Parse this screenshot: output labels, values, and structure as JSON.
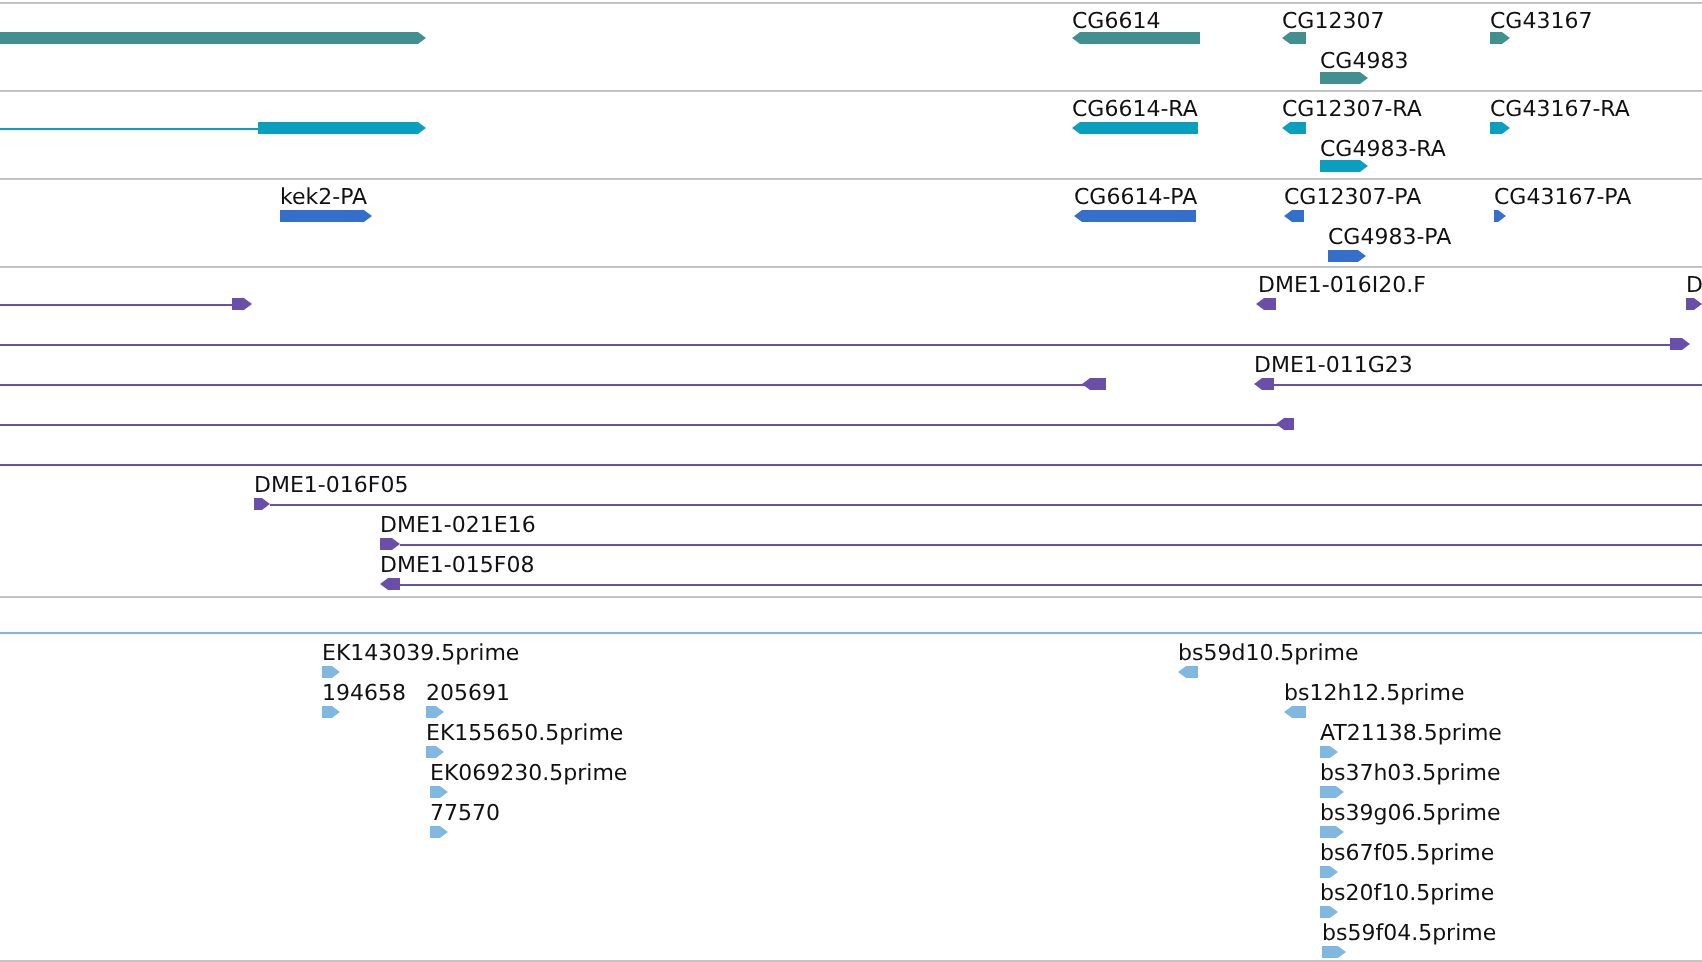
{
  "tracks": [
    {
      "color": "#418f8f",
      "features": [
        {
          "reverse": false
        },
        {
          "label": "CG6614",
          "reverse": true
        },
        {
          "label": "CG12307",
          "reverse": true
        },
        {
          "label": "CG4983",
          "reverse": false
        },
        {
          "label": "CG43167",
          "reverse": false
        }
      ]
    },
    {
      "color": "#0a9fbf",
      "features": [
        {
          "reverse": false
        },
        {
          "label": "CG6614-RA",
          "reverse": true
        },
        {
          "label": "CG12307-RA",
          "reverse": true
        },
        {
          "label": "CG4983-RA",
          "reverse": false
        },
        {
          "label": "CG43167-RA",
          "reverse": false
        }
      ]
    },
    {
      "color": "#356fcc",
      "features": [
        {
          "label": "kek2-PA",
          "reverse": false
        },
        {
          "label": "CG6614-PA",
          "reverse": true
        },
        {
          "label": "CG12307-PA",
          "reverse": true
        },
        {
          "label": "CG4983-PA",
          "reverse": false
        },
        {
          "label": "CG43167-PA",
          "reverse": false
        }
      ]
    },
    {
      "color": "#6a4fa8",
      "features": [
        {
          "kind": "arrow",
          "reverse": false
        },
        {
          "kind": "arrow",
          "label": "DME1-016I20.F",
          "reverse": true
        },
        {
          "kind": "arrow",
          "label": "D",
          "reverse": false
        },
        {
          "kind": "arrow",
          "reverse": false
        },
        {
          "kind": "arrow",
          "reverse": true
        },
        {
          "kind": "arrow",
          "label": "DME1-011G23",
          "reverse": true
        },
        {
          "kind": "arrow",
          "reverse": true
        },
        {
          "kind": "line"
        },
        {
          "kind": "arrow",
          "label": "DME1-016F05",
          "reverse": false
        },
        {
          "kind": "arrow",
          "label": "DME1-021E16",
          "reverse": false
        },
        {
          "kind": "arrow",
          "label": "DME1-015F08",
          "reverse": true
        }
      ]
    },
    {
      "color": "#80b8e0",
      "features": [
        {
          "label": "EK143039.5prime",
          "reverse": false
        },
        {
          "label": "194658",
          "reverse": false
        },
        {
          "label": "205691",
          "reverse": false
        },
        {
          "label": "EK155650.5prime",
          "reverse": false
        },
        {
          "label": "EK069230.5prime",
          "reverse": false
        },
        {
          "label": "77570",
          "reverse": false
        },
        {
          "label": "bs59d10.5prime",
          "reverse": true
        },
        {
          "label": "bs12h12.5prime",
          "reverse": true
        },
        {
          "label": "AT21138.5prime",
          "reverse": false
        },
        {
          "label": "bs37h03.5prime",
          "reverse": false
        },
        {
          "label": "bs39g06.5prime",
          "reverse": false
        },
        {
          "label": "bs67f05.5prime",
          "reverse": false
        },
        {
          "label": "bs20f10.5prime",
          "reverse": false
        },
        {
          "label": "bs59f04.5prime",
          "reverse": false
        }
      ]
    }
  ]
}
